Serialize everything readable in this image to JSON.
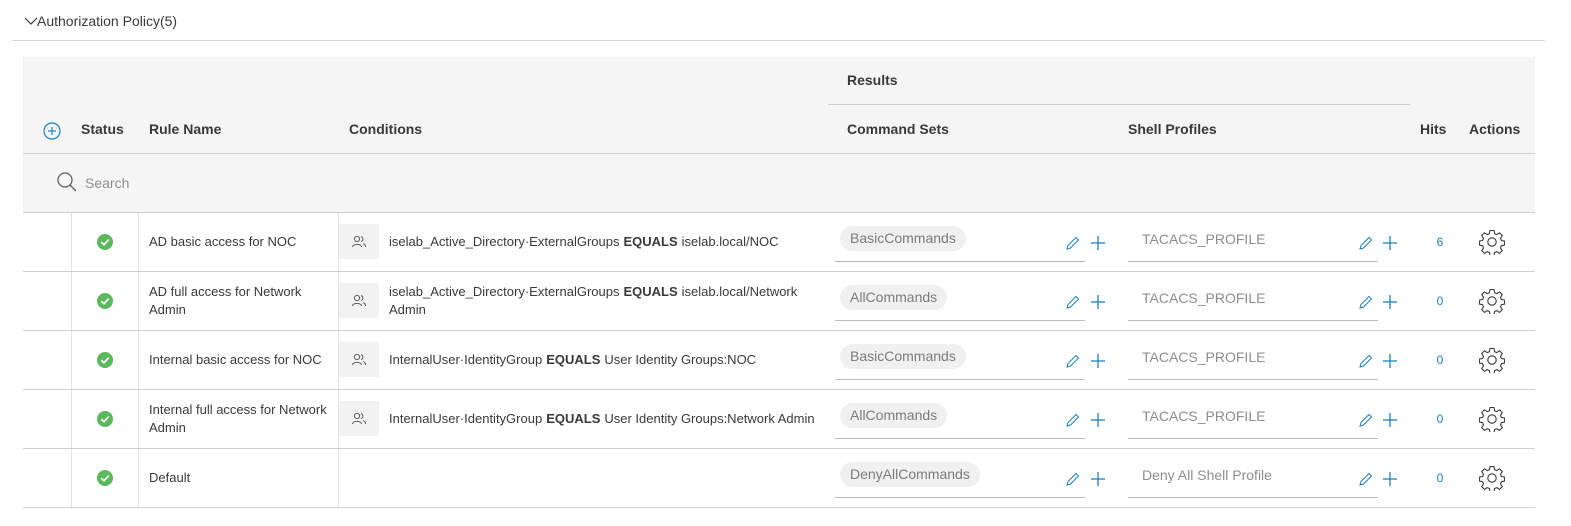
{
  "section": {
    "title": "Authorization Policy(5)"
  },
  "columns": {
    "status": "Status",
    "rule_name": "Rule Name",
    "conditions": "Conditions",
    "results": "Results",
    "command_sets": "Command Sets",
    "shell_profiles": "Shell Profiles",
    "hits": "Hits",
    "actions": "Actions"
  },
  "search": {
    "placeholder": "Search"
  },
  "colors": {
    "accent": "#1e7fc0",
    "status_ok": "#5cb85c"
  },
  "rows": [
    {
      "name": "AD basic access for NOC",
      "cond_attr": "iselab_Active_Directory·ExternalGroups",
      "cond_op": "EQUALS",
      "cond_value": "iselab.local/NOC",
      "command_set": "BasicCommands",
      "shell_profile": "TACACS_PROFILE",
      "hits": "6"
    },
    {
      "name": "AD full access for Network Admin",
      "cond_attr": "iselab_Active_Directory·ExternalGroups",
      "cond_op": "EQUALS",
      "cond_value": "iselab.local/Network Admin",
      "command_set": "AllCommands",
      "shell_profile": "TACACS_PROFILE",
      "hits": "0"
    },
    {
      "name": "Internal basic access for NOC",
      "cond_attr": "InternalUser·IdentityGroup",
      "cond_op": "EQUALS",
      "cond_value": "User Identity Groups:NOC",
      "command_set": "BasicCommands",
      "shell_profile": "TACACS_PROFILE",
      "hits": "0"
    },
    {
      "name": "Internal full access for Network Admin",
      "cond_attr": "InternalUser·IdentityGroup",
      "cond_op": "EQUALS",
      "cond_value": "User Identity Groups:Network Admin",
      "command_set": "AllCommands",
      "shell_profile": "TACACS_PROFILE",
      "hits": "0"
    },
    {
      "name": "Default",
      "cond_attr": "",
      "cond_op": "",
      "cond_value": "",
      "command_set": "DenyAllCommands",
      "shell_profile": "Deny All Shell Profile",
      "hits": "0"
    }
  ]
}
